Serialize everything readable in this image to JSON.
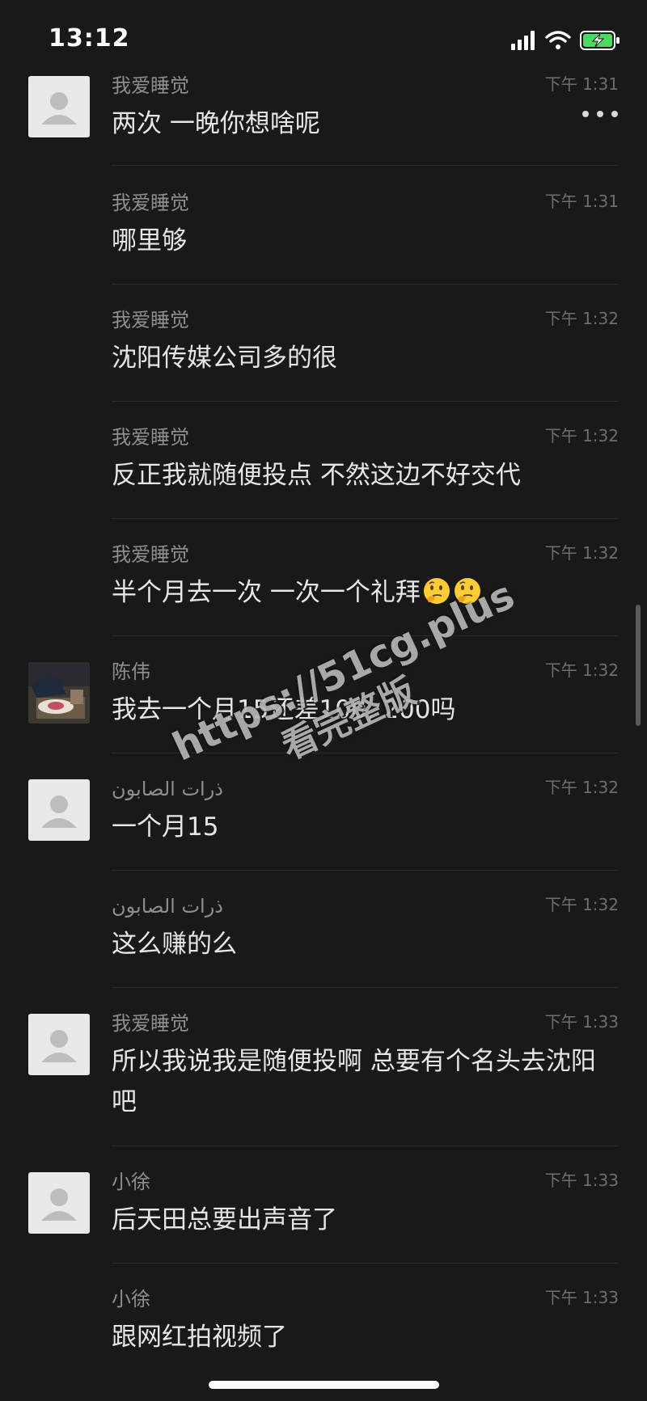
{
  "status_bar": {
    "time": "13:12",
    "icons": [
      "signal-icon",
      "wifi-icon",
      "battery-charging-icon"
    ],
    "battery_color": "#4cd964"
  },
  "nav": {
    "back_icon": "chevron-left-icon",
    "more_icon": "more-dots-icon"
  },
  "messages": [
    {
      "sender": "我爱睡觉",
      "time": "下午 1:31",
      "text": "两次 一晚你想啥呢",
      "avatar": "default-avatar"
    },
    {
      "sender": "我爱睡觉",
      "time": "下午 1:31",
      "text": "哪里够"
    },
    {
      "sender": "我爱睡觉",
      "time": "下午 1:32",
      "text": "沈阳传媒公司多的很"
    },
    {
      "sender": "我爱睡觉",
      "time": "下午 1:32",
      "text": "反正我就随便投点 不然这边不好交代"
    },
    {
      "sender": "我爱睡觉",
      "time": "下午 1:32",
      "text": "半个月去一次 一次一个礼拜",
      "emoji": "thinking-face-icon"
    },
    {
      "sender": "陈伟",
      "time": "下午 1:32",
      "text": "我去一个月15还差100, 200吗",
      "avatar": "photo-avatar"
    },
    {
      "sender": "ذرات الصابون",
      "time": "下午 1:32",
      "text": "一个月15",
      "avatar": "default-avatar"
    },
    {
      "sender": "ذرات الصابون",
      "time": "下午 1:32",
      "text": "这么赚的么"
    },
    {
      "sender": "我爱睡觉",
      "time": "下午 1:33",
      "text": "所以我说我是随便投啊 总要有个名头去沈阳吧",
      "avatar": "default-avatar"
    },
    {
      "sender": "小徐",
      "time": "下午 1:33",
      "text": "后天田总要出声音了",
      "avatar": "default-avatar"
    },
    {
      "sender": "小徐",
      "time": "下午 1:33",
      "text": "跟网红拍视频了"
    }
  ],
  "watermark": {
    "url": "https://51cg.plus",
    "subtitle": "看完整版"
  }
}
